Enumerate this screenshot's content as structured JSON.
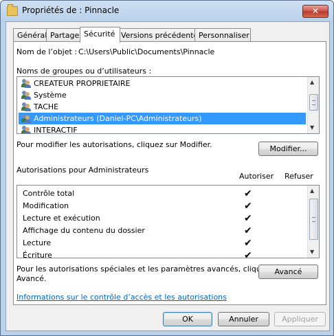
{
  "window": {
    "title": "Propriétés de : Pinnacle",
    "close_label": "✕"
  },
  "tabs": [
    {
      "label": "Général"
    },
    {
      "label": "Partage"
    },
    {
      "label": "Sécurité",
      "active": true
    },
    {
      "label": "Versions précédentes"
    },
    {
      "label": "Personnaliser"
    }
  ],
  "object": {
    "label": "Nom de l’objet :",
    "value": "C:\\Users\\Public\\Documents\\Pinnacle"
  },
  "users": {
    "label": "Noms de groupes ou d’utilisateurs :",
    "items": [
      {
        "name": "CREATEUR PROPRIETAIRE",
        "selected": false
      },
      {
        "name": "Système",
        "selected": false
      },
      {
        "name": "TACHE",
        "selected": false
      },
      {
        "name": "Administrateurs (Daniel-PC\\Administrateurs)",
        "selected": true
      },
      {
        "name": "INTERACTIF",
        "selected": false
      }
    ]
  },
  "modify": {
    "hint": "Pour modifier les autorisations, cliquez sur Modifier.",
    "button_label": "Modifier..."
  },
  "permissions": {
    "label": "Autorisations pour Administrateurs",
    "col_allow": "Autoriser",
    "col_deny": "Refuser",
    "check_glyph": "✔",
    "items": [
      {
        "name": "Contrôle total",
        "allow": true,
        "deny": false
      },
      {
        "name": "Modification",
        "allow": true,
        "deny": false
      },
      {
        "name": "Lecture et exécution",
        "allow": true,
        "deny": false
      },
      {
        "name": "Affichage du contenu du dossier",
        "allow": true,
        "deny": false
      },
      {
        "name": "Lecture",
        "allow": true,
        "deny": false
      },
      {
        "name": "Écriture",
        "allow": true,
        "deny": false
      }
    ]
  },
  "advanced": {
    "hint_line1": "Pour les autorisations spéciales et les paramètres avancés, cliquez sur",
    "hint_line2": "Avancé.",
    "button_label": "Avancé"
  },
  "info_link": "Informations sur le contrôle d’accès et les autorisations",
  "footer": {
    "ok": "OK",
    "cancel": "Annuler",
    "apply": "Appliquer"
  },
  "colors": {
    "selection": "#3399ff",
    "link": "#0066cc",
    "close": "#c75050"
  }
}
